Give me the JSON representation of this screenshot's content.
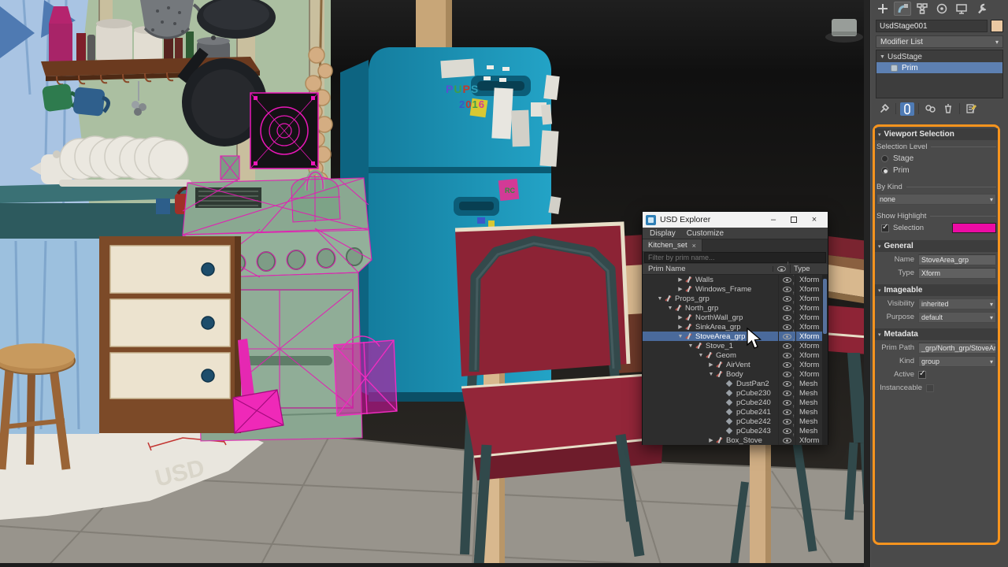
{
  "colors": {
    "callout_orange": "#f7941e",
    "highlight_magenta": "#ec0ba4",
    "selection_wireframe": "#e519b4",
    "stack_selection_blue": "#5d80b2",
    "fridge_teal": "#1b92b4",
    "chair_red": "#8e2436"
  },
  "scene": {
    "rug_text": "USD",
    "fridge_note_letters": "RC",
    "magnet_letters": [
      {
        "ch": "P",
        "color": "#5a4fd0"
      },
      {
        "ch": "U",
        "color": "#3e9e49"
      },
      {
        "ch": "P",
        "color": "#c03a2e"
      },
      {
        "ch": "S",
        "color": "#2f9fb8"
      }
    ],
    "magnet_year": [
      {
        "ch": "2",
        "color": "#3a57c9"
      },
      {
        "ch": "0",
        "color": "#c23830"
      },
      {
        "ch": "1",
        "color": "#3e9e49"
      },
      {
        "ch": "6",
        "color": "#d23a96"
      }
    ]
  },
  "explorer": {
    "window_title": "USD Explorer",
    "window_controls": {
      "minimize": "–",
      "close": "×"
    },
    "menu_items": [
      "Display",
      "Customize"
    ],
    "tab_label": "Kitchen_set",
    "tab_close": "×",
    "filter_placeholder": "Filter by prim name...",
    "columns": {
      "name": "Prim Name",
      "type": "Type"
    },
    "rows": [
      {
        "name": "Walls",
        "type": "Xform",
        "arrow": "▶",
        "icon": "xform",
        "selected": false
      },
      {
        "name": "Windows_Frame",
        "type": "Xform",
        "arrow": "▶",
        "icon": "xform",
        "selected": false
      },
      {
        "name": "Props_grp",
        "type": "Xform",
        "arrow": "▼",
        "icon": "xform",
        "selected": false
      },
      {
        "name": "North_grp",
        "type": "Xform",
        "arrow": "▼",
        "icon": "xform",
        "selected": false
      },
      {
        "name": "NorthWall_grp",
        "type": "Xform",
        "arrow": "▶",
        "icon": "xform",
        "selected": false
      },
      {
        "name": "SinkArea_grp",
        "type": "Xform",
        "arrow": "▶",
        "icon": "xform",
        "selected": false
      },
      {
        "name": "StoveArea_grp",
        "type": "Xform",
        "arrow": "▼",
        "icon": "xform",
        "selected": true
      },
      {
        "name": "Stove_1",
        "type": "Xform",
        "arrow": "▼",
        "icon": "xform",
        "selected": false
      },
      {
        "name": "Geom",
        "type": "Xform",
        "arrow": "▼",
        "icon": "xform",
        "selected": false
      },
      {
        "name": "AirVent",
        "type": "Xform",
        "arrow": "▶",
        "icon": "xform",
        "selected": false
      },
      {
        "name": "Body",
        "type": "Xform",
        "arrow": "▼",
        "icon": "xform",
        "selected": false
      },
      {
        "name": "DustPan2",
        "type": "Mesh",
        "arrow": "",
        "icon": "mesh",
        "selected": false
      },
      {
        "name": "pCube230",
        "type": "Mesh",
        "arrow": "",
        "icon": "mesh",
        "selected": false
      },
      {
        "name": "pCube240",
        "type": "Mesh",
        "arrow": "",
        "icon": "mesh",
        "selected": false
      },
      {
        "name": "pCube241",
        "type": "Mesh",
        "arrow": "",
        "icon": "mesh",
        "selected": false
      },
      {
        "name": "pCube242",
        "type": "Mesh",
        "arrow": "",
        "icon": "mesh",
        "selected": false
      },
      {
        "name": "pCube243",
        "type": "Mesh",
        "arrow": "",
        "icon": "mesh",
        "selected": false
      },
      {
        "name": "Box_Stove",
        "type": "Xform",
        "arrow": "▶",
        "icon": "xform",
        "selected": false
      }
    ]
  },
  "panel": {
    "object_name": "UsdStage001",
    "modifier_list_label": "Modifier List",
    "stack": [
      {
        "label": "UsdStage",
        "selected": false
      },
      {
        "label": "Prim",
        "selected": true
      }
    ],
    "viewport_selection": {
      "title": "Viewport Selection",
      "selection_level_label": "Selection Level",
      "radio_stage": "Stage",
      "radio_prim": "Prim",
      "selection_level_value": "Prim",
      "by_kind_label": "By Kind",
      "by_kind_value": "none",
      "show_highlight_label": "Show Highlight",
      "selection_checkbox_label": "Selection",
      "selection_checkbox_checked": true,
      "highlight_color": "#ec0ba4"
    },
    "general": {
      "title": "General",
      "name_label": "Name",
      "name_value": "StoveArea_grp",
      "type_label": "Type",
      "type_value": "Xform"
    },
    "imageable": {
      "title": "Imageable",
      "visibility_label": "Visibility",
      "visibility_value": "inherited",
      "purpose_label": "Purpose",
      "purpose_value": "default"
    },
    "metadata": {
      "title": "Metadata",
      "prim_path_label": "Prim Path",
      "prim_path_value": "_grp/North_grp/StoveArea_grp",
      "kind_label": "Kind",
      "kind_value": "group",
      "active_label": "Active",
      "active_checked": true,
      "instanceable_label": "Instanceable",
      "instanceable_checked": false
    }
  }
}
